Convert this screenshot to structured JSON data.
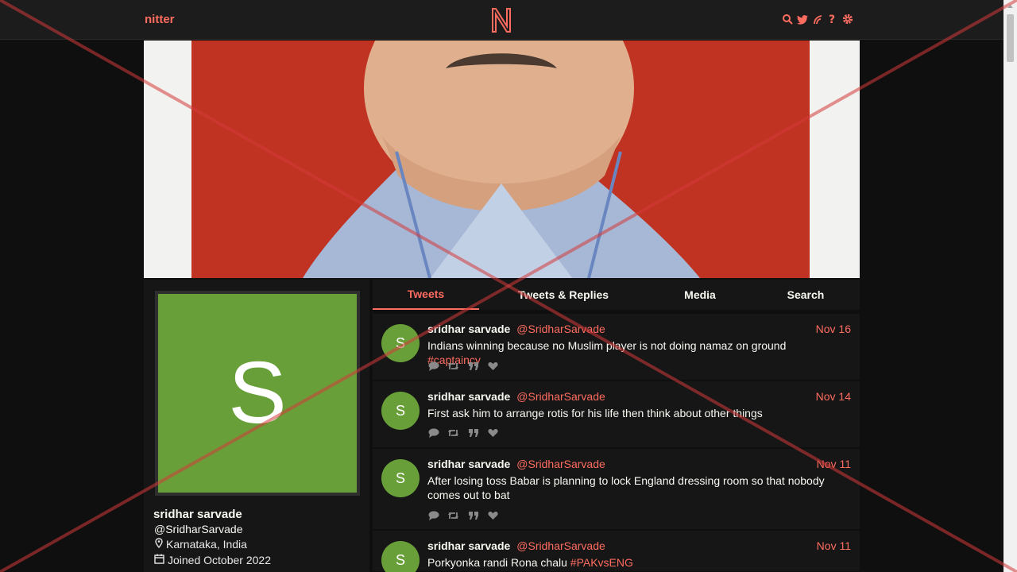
{
  "nav": {
    "brand": "nitter",
    "icons": [
      "search-icon",
      "twitter-icon",
      "rss-icon",
      "help-icon",
      "settings-icon"
    ]
  },
  "colors": {
    "accent": "#ff6c60",
    "avatar_bg": "#689f38",
    "card_bg": "#161616",
    "page_bg": "#0f0f0f"
  },
  "profile": {
    "initial": "S",
    "name": "sridhar sarvade",
    "handle": "@SridharSarvade",
    "location": "Karnataka, India",
    "joined": "Joined October 2022"
  },
  "tabs": [
    "Tweets",
    "Tweets & Replies",
    "Media",
    "Search"
  ],
  "tweets": [
    {
      "initial": "S",
      "name": "sridhar sarvade",
      "handle": "@SridharSarvade",
      "date": "Nov 16",
      "text": "Indians winning because no Muslim player is not doing namaz on ground ",
      "hashtag": "#captaincy"
    },
    {
      "initial": "S",
      "name": "sridhar sarvade",
      "handle": "@SridharSarvade",
      "date": "Nov 14",
      "text": "First ask him to arrange rotis for his life then think about other things",
      "hashtag": ""
    },
    {
      "initial": "S",
      "name": "sridhar sarvade",
      "handle": "@SridharSarvade",
      "date": "Nov 11",
      "text": "After losing toss Babar is planning to lock England dressing room so that nobody comes out to bat",
      "hashtag": ""
    },
    {
      "initial": "S",
      "name": "sridhar sarvade",
      "handle": "@SridharSarvade",
      "date": "Nov 11",
      "text": "Porkyonka randi Rona chalu ",
      "hashtag": "#PAKvsENG"
    }
  ]
}
